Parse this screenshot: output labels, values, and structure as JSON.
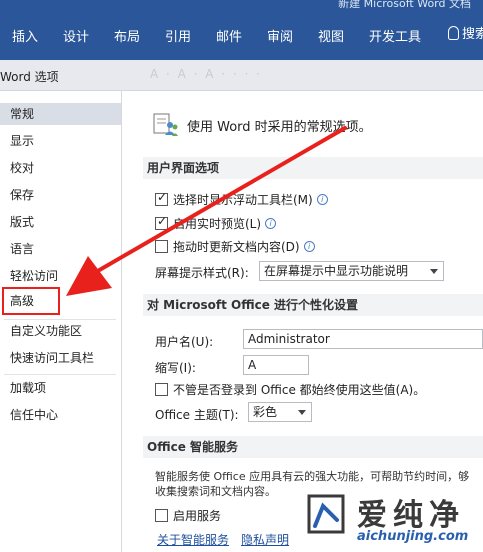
{
  "window": {
    "title": "新建 Microsoft Word 文档"
  },
  "ribbon": {
    "tabs": [
      "插入",
      "设计",
      "布局",
      "引用",
      "邮件",
      "审阅",
      "视图",
      "开发工具"
    ],
    "tell_me": "搜索"
  },
  "dialog": {
    "title": "Word 选项",
    "ghost_title": "A · A · A · · · ·"
  },
  "sidebar": {
    "items": [
      "常规",
      "显示",
      "校对",
      "保存",
      "版式",
      "语言",
      "轻松访问",
      "高级",
      "自定义功能区",
      "快速访问工具栏",
      "加载项",
      "信任中心"
    ],
    "active_index": 0,
    "highlighted_index": 7
  },
  "content": {
    "header": "使用 Word 时采用的常规选项。",
    "ui_section": {
      "title": "用户界面选项",
      "options": [
        {
          "label": "选择时显示浮动工具栏(M)",
          "checked": true,
          "info": true
        },
        {
          "label": "启用实时预览(L)",
          "checked": true,
          "info": true
        },
        {
          "label": "拖动时更新文档内容(D)",
          "checked": false,
          "info": true
        }
      ],
      "screentip_label": "屏幕提示样式(R):",
      "screentip_value": "在屏幕提示中显示功能说明"
    },
    "personalize_section": {
      "title": "对 Microsoft Office 进行个性化设置",
      "username_label": "用户名(U):",
      "username_value": "Administrator",
      "initials_label": "缩写(I):",
      "initials_value": "A",
      "always_use_label": "不管是否登录到 Office 都始终使用这些值(A)。",
      "theme_label": "Office 主题(T):",
      "theme_value": "彩色"
    },
    "intelligent_section": {
      "title": "Office 智能服务",
      "description": "智能服务使 Office 应用具有云的强大功能，可帮助节约时间，够收集搜索词和文档内容。",
      "enable_label": "启用服务",
      "about_link": "关于智能服务",
      "privacy_link": "隐私声明"
    }
  },
  "watermark": {
    "brand": "爱纯净",
    "url": "aichunjing.com"
  },
  "colors": {
    "ribbon": "#2b579a",
    "annotation": "#e8211c",
    "link": "#1e4e9c"
  }
}
